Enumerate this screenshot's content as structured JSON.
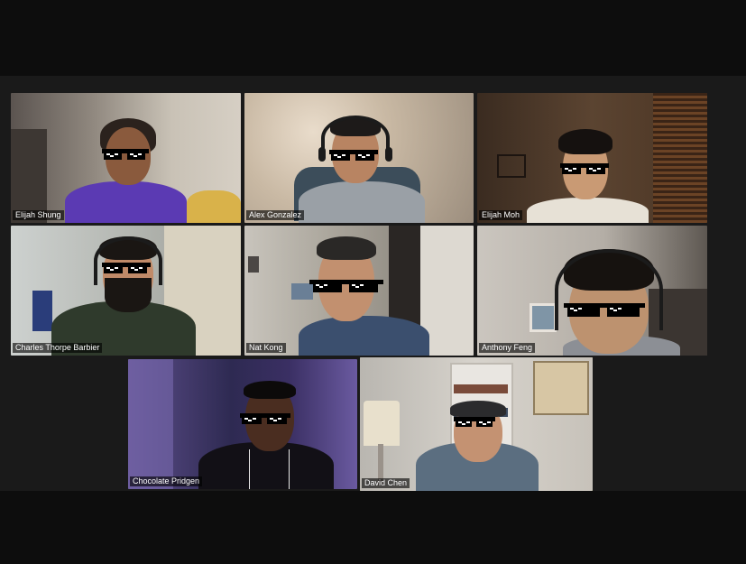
{
  "meeting": {
    "participants": [
      {
        "name": "Elijah Shung"
      },
      {
        "name": "Alex Gonzalez"
      },
      {
        "name": "Elijah Moh"
      },
      {
        "name": "Charles Thorpe Barbier"
      },
      {
        "name": "Nat Kong"
      },
      {
        "name": "Anthony Feng"
      },
      {
        "name": "Chocolate Pridgen"
      },
      {
        "name": "David Chen"
      }
    ],
    "active_speaker": "David Chen",
    "colors": {
      "active_border": "#d8f06c",
      "background": "#1a1a1a",
      "bars": "#0d0d0d"
    }
  }
}
